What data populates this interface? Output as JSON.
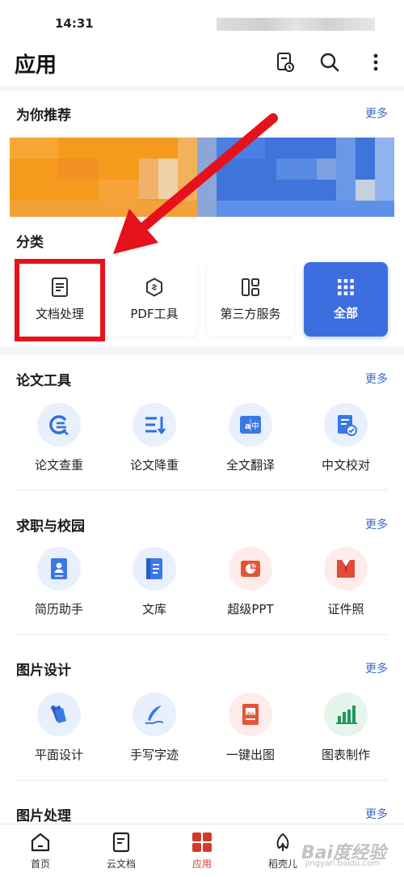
{
  "status": {
    "time": "14:31"
  },
  "header": {
    "title": "应用",
    "icons": [
      "history-doc-icon",
      "search-icon",
      "more-vert-icon"
    ]
  },
  "recommend": {
    "title": "为你推荐",
    "more": "更多"
  },
  "categories": {
    "title": "分类",
    "items": [
      {
        "label": "文档处理",
        "icon": "document-icon"
      },
      {
        "label": "PDF工具",
        "icon": "pdf-link-icon"
      },
      {
        "label": "第三方服务",
        "icon": "layout-grid-icon"
      },
      {
        "label": "全部",
        "icon": "apps-grid-icon"
      }
    ]
  },
  "sections": [
    {
      "title": "论文工具",
      "more": "更多",
      "items": [
        {
          "label": "论文查重",
          "icon": "plagiarism-check-icon"
        },
        {
          "label": "论文降重",
          "icon": "reduce-duplication-icon"
        },
        {
          "label": "全文翻译",
          "icon": "translate-icon"
        },
        {
          "label": "中文校对",
          "icon": "proofread-icon"
        }
      ]
    },
    {
      "title": "求职与校园",
      "more": "更多",
      "items": [
        {
          "label": "简历助手",
          "icon": "resume-icon"
        },
        {
          "label": "文库",
          "icon": "library-icon"
        },
        {
          "label": "超级PPT",
          "icon": "ppt-icon"
        },
        {
          "label": "证件照",
          "icon": "id-photo-icon"
        }
      ]
    },
    {
      "title": "图片设计",
      "more": "更多",
      "items": [
        {
          "label": "平面设计",
          "icon": "graphic-design-icon"
        },
        {
          "label": "手写字迹",
          "icon": "handwriting-icon"
        },
        {
          "label": "一键出图",
          "icon": "one-click-image-icon"
        },
        {
          "label": "图表制作",
          "icon": "chart-maker-icon"
        }
      ]
    },
    {
      "title": "图片处理",
      "more": "更多",
      "items": []
    }
  ],
  "tabbar": {
    "items": [
      {
        "label": "首页",
        "icon": "home-icon"
      },
      {
        "label": "云文档",
        "icon": "cloud-doc-icon"
      },
      {
        "label": "应用",
        "icon": "apps-icon"
      },
      {
        "label": "稻壳儿",
        "icon": "leaf-icon"
      }
    ],
    "active": "应用"
  },
  "watermark": {
    "text": "Bai度经验",
    "sub": "jingyan.baidu.com"
  },
  "colors": {
    "accent": "#3d6ee0",
    "highlight": "#e5121c",
    "more": "#3d68c8",
    "active_tab": "#d23b2c"
  }
}
